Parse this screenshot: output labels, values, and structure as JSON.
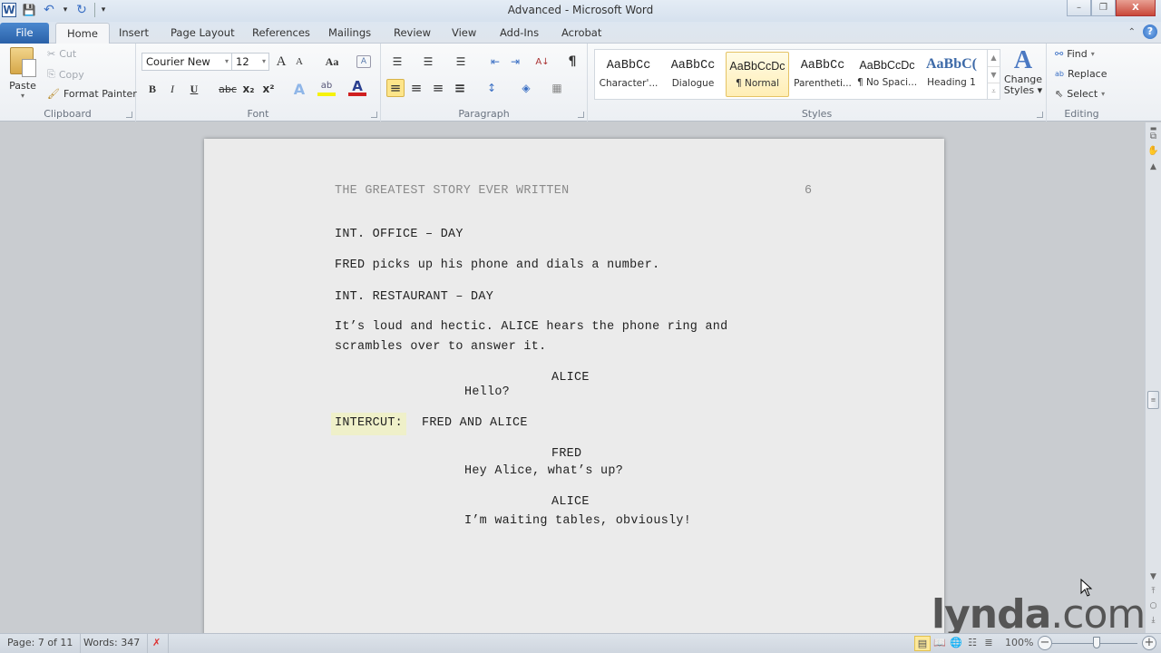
{
  "window": {
    "title": "Advanced - Microsoft Word",
    "controls": {
      "minimize": "–",
      "restore": "❐",
      "close": "X"
    }
  },
  "quick_access": {
    "app_icon": "W",
    "save": "💾",
    "undo": "↶",
    "undo_dropdown": "▾",
    "redo": "↻",
    "customize": "▾"
  },
  "tabs": [
    {
      "label": "File"
    },
    {
      "label": "Home",
      "active": true
    },
    {
      "label": "Insert"
    },
    {
      "label": "Page Layout"
    },
    {
      "label": "References"
    },
    {
      "label": "Mailings"
    },
    {
      "label": "Review"
    },
    {
      "label": "View"
    },
    {
      "label": "Add-Ins"
    },
    {
      "label": "Acrobat"
    }
  ],
  "help": {
    "minimize_ribbon": "⌃",
    "help": "?"
  },
  "ribbon": {
    "clipboard": {
      "label": "Clipboard",
      "paste": "Paste",
      "cut": "Cut",
      "copy": "Copy",
      "format_painter": "Format Painter"
    },
    "font": {
      "label": "Font",
      "font_name": "Courier New",
      "font_size": "12",
      "grow": "A",
      "shrink": "A",
      "change_case": "Aa",
      "clear": "A",
      "bold": "B",
      "italic": "I",
      "underline": "U",
      "strike": "abc",
      "subscript": "x₂",
      "superscript": "x²",
      "text_effects": "A",
      "highlight": "ab",
      "font_color": "A",
      "highlight_color": "#f6f20a",
      "font_color_value": "#d01f1f"
    },
    "paragraph": {
      "label": "Paragraph",
      "bullets": "☰",
      "numbering": "☰",
      "multilevel": "☰",
      "decrease_indent": "⇤",
      "increase_indent": "⇥",
      "sort": "A↓",
      "show_marks": "¶",
      "align_left": "≡",
      "center": "≡",
      "align_right": "≡",
      "justify": "≡",
      "line_spacing": "↕",
      "shading": "◈",
      "borders": "▦"
    },
    "styles": {
      "label": "Styles",
      "items": [
        {
          "preview": "AaBbCc",
          "name": "Character'..."
        },
        {
          "preview": "AaBbCc",
          "name": "Dialogue"
        },
        {
          "preview": "AaBbCcDc",
          "name": "¶ Normal",
          "selected": true
        },
        {
          "preview": "AaBbCc",
          "name": "Parentheti..."
        },
        {
          "preview": "AaBbCcDc",
          "name": "¶ No Spaci..."
        },
        {
          "preview": "AaBbC(",
          "name": "Heading 1"
        }
      ],
      "change_styles": "Change Styles",
      "change_styles_line1": "Change",
      "change_styles_line2": "Styles ▾"
    },
    "editing": {
      "label": "Editing",
      "find": "Find",
      "replace": "Replace",
      "select": "Select"
    }
  },
  "document": {
    "header_title": "THE GREATEST STORY EVER WRITTEN",
    "page_number": "6",
    "lines": {
      "scene1": "INT. OFFICE – DAY",
      "action1": "FRED picks up his phone and dials a number.",
      "scene2": "INT. RESTAURANT – DAY",
      "action2_l1": "It’s loud and hectic. ALICE hears the phone ring and",
      "action2_l2": "scrambles over to answer it.",
      "char1": "ALICE",
      "dia1": "Hello?",
      "intercut_label": "INTERCUT:",
      "intercut_rest": "FRED AND ALICE",
      "char2": "FRED",
      "dia2": "Hey Alice, what’s up?",
      "char3": "ALICE",
      "dia3": "I’m waiting tables, obviously!"
    }
  },
  "statusbar": {
    "page": "Page: 7 of 11",
    "words": "Words: 347",
    "proofing_icon": "✗",
    "zoom_level": "100%",
    "zoom_minus": "−",
    "zoom_plus": "+",
    "zoom_percent": 100
  },
  "watermark": {
    "brand": "lynda",
    "suffix": ".com"
  }
}
